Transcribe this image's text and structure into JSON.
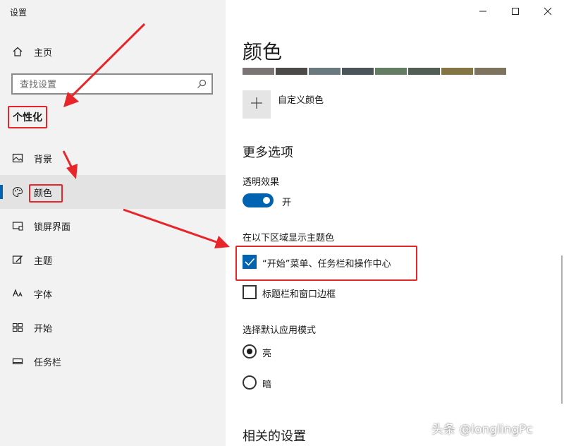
{
  "window": {
    "title": "设置",
    "controls": {
      "minimize_icon": "minimize-icon",
      "maximize_icon": "maximize-icon",
      "close_icon": "close-icon"
    }
  },
  "sidebar": {
    "home": {
      "label": "主页",
      "icon": "home-icon"
    },
    "search": {
      "placeholder": "查找设置",
      "icon": "search-icon"
    },
    "section": "个性化",
    "items": [
      {
        "label": "背景",
        "icon": "image-icon",
        "selected": false
      },
      {
        "label": "颜色",
        "icon": "palette-icon",
        "selected": true
      },
      {
        "label": "锁屏界面",
        "icon": "lockscreen-icon",
        "selected": false
      },
      {
        "label": "主题",
        "icon": "theme-icon",
        "selected": false
      },
      {
        "label": "字体",
        "icon": "font-icon",
        "selected": false
      },
      {
        "label": "开始",
        "icon": "start-icon",
        "selected": false
      },
      {
        "label": "任务栏",
        "icon": "taskbar-icon",
        "selected": false
      }
    ]
  },
  "main": {
    "title": "颜色",
    "swatches": [
      "#7a7574",
      "#4c4a48",
      "#69797e",
      "#4a5459",
      "#647c64",
      "#525e54",
      "#847545",
      "#7e735f"
    ],
    "custom_color": {
      "label": "自定义颜色",
      "icon": "plus-icon"
    },
    "more_options": "更多选项",
    "transparency": {
      "label": "透明效果",
      "state": "开",
      "on": true
    },
    "accent_surfaces": {
      "label": "在以下区域显示主题色",
      "options": [
        {
          "label": "“开始”菜单、任务栏和操作中心",
          "checked": true
        },
        {
          "label": "标题栏和窗口边框",
          "checked": false
        }
      ]
    },
    "app_mode": {
      "label": "选择默认应用模式",
      "options": [
        {
          "label": "亮",
          "selected": true
        },
        {
          "label": "暗",
          "selected": false
        }
      ]
    },
    "related": "相关的设置"
  },
  "watermark": "头条 @longlingPc",
  "colors": {
    "accent": "#0063b1",
    "annotation_red": "#e8262a",
    "sidebar_bg": "#f2f2f2",
    "selected_bg": "#e3e3e3"
  }
}
